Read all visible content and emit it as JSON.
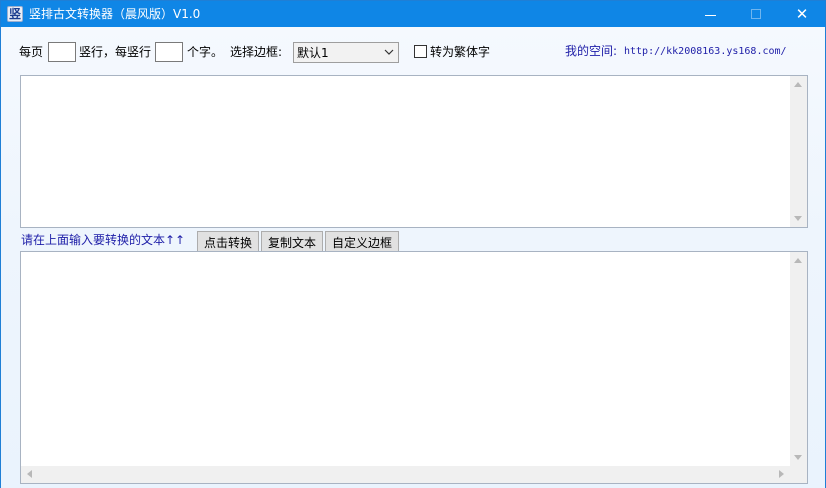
{
  "window": {
    "title": "竖排古文转换器（晨风版）V1.0",
    "app_icon_glyph": "竖",
    "minimize_icon": "minimize-icon",
    "maximize_icon": "maximize-icon",
    "close_icon": "close-icon",
    "close_glyph": "✕"
  },
  "toolbar": {
    "per_page_label": "每页",
    "per_page_value": "",
    "columns_label": "竖行，每竖行",
    "chars_per_column_value": "",
    "chars_label": "个字。",
    "border_label": "选择边框:",
    "border_selected": "默认1",
    "traditional_checked": false,
    "traditional_label": "转为繁体字",
    "space_label": "我的空间:",
    "space_url": "http://kk2008163.ys168.com/"
  },
  "input_area": {
    "value": ""
  },
  "actions": {
    "hint": "请在上面输入要转换的文本↑↑",
    "convert_label": "点击转换",
    "copy_label": "复制文本",
    "custom_border_label": "自定义边框"
  },
  "output_area": {
    "value": ""
  },
  "colors": {
    "titlebar": "#0f86e6",
    "link_text": "#1e1ea8",
    "button_face": "#e1e1e1"
  }
}
